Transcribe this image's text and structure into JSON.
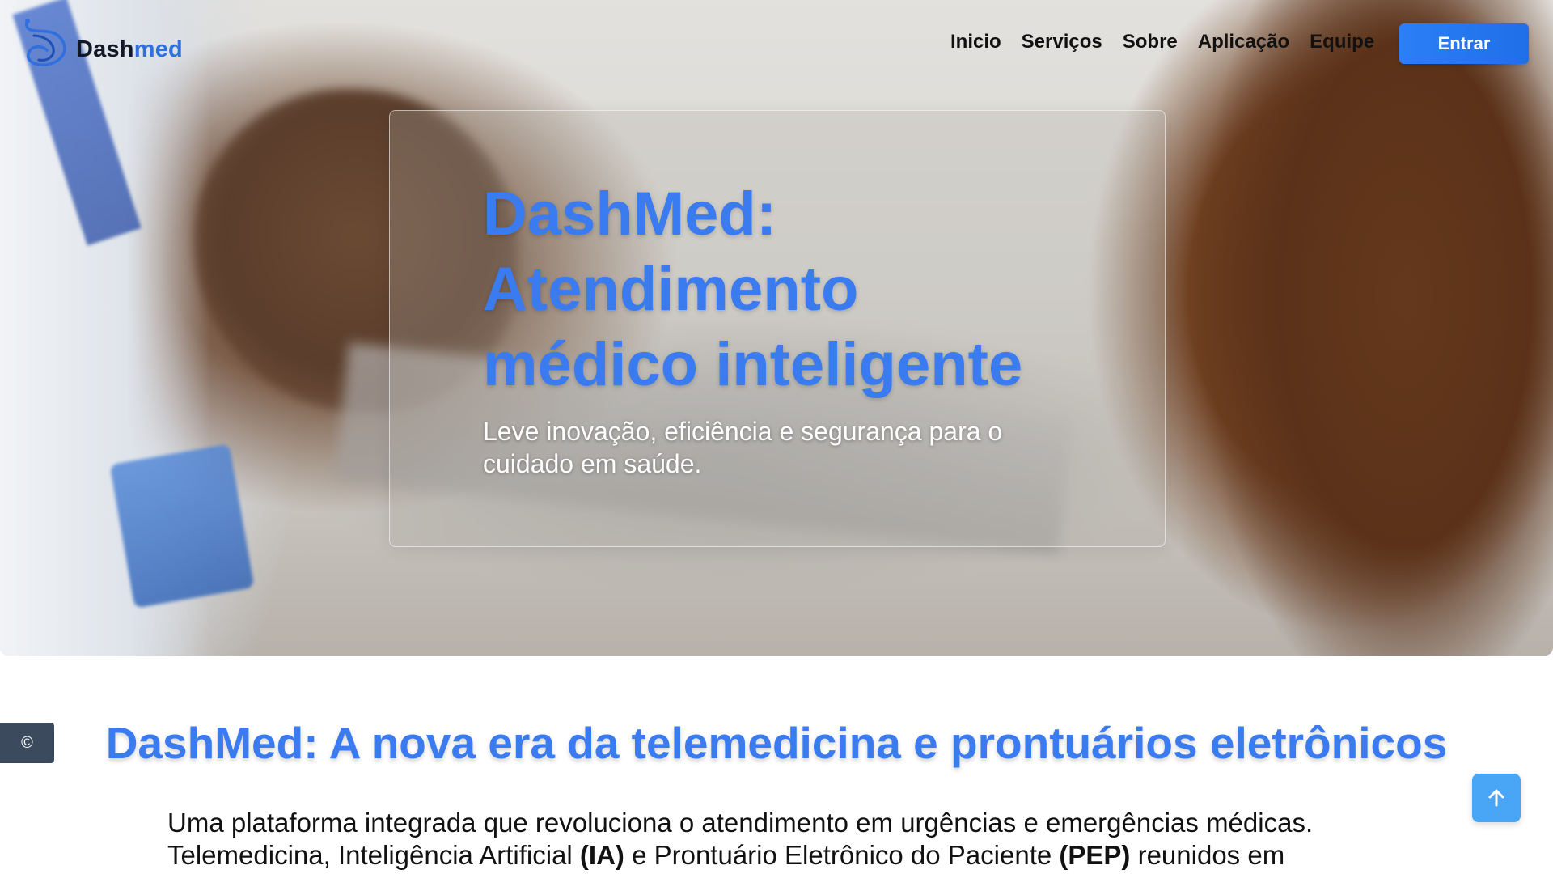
{
  "brand": {
    "name_part1": "Dash",
    "name_part2": "med",
    "logo_icon": "dashmed-logo-icon",
    "accent_color": "#3b7bf0"
  },
  "nav": {
    "items": [
      {
        "label": "Inicio"
      },
      {
        "label": "Serviços"
      },
      {
        "label": "Sobre"
      },
      {
        "label": "Aplicação"
      },
      {
        "label": "Equipe"
      }
    ],
    "enter_label": "Entrar"
  },
  "hero": {
    "title": "DashMed: Atendimento médico inteligente",
    "subtitle": "Leve inovação, eficiência e segurança para o cuidado em saúde."
  },
  "section": {
    "title": "DashMed: A nova era da telemedicina e prontuários eletrônicos",
    "line1": "Uma plataforma integrada que revoluciona o atendimento em urgências e emergências médicas.",
    "line2_part1": "Telemedicina, Inteligência Artificial ",
    "line2_bold1": "(IA)",
    "line2_part2": " e Prontuário Eletrônico do Paciente ",
    "line2_bold2": "(PEP)",
    "line2_part3": " reunidos em"
  },
  "side_badge": {
    "symbol": "©",
    "icon": "copyright-icon"
  },
  "scroll_top": {
    "icon": "arrow-up-icon"
  }
}
